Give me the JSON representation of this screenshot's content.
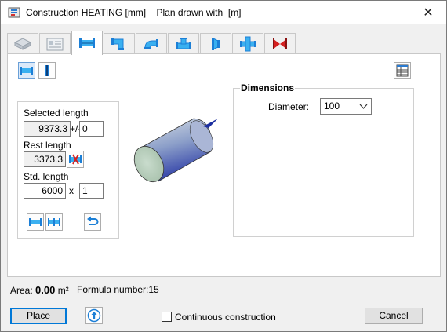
{
  "window": {
    "title": "Construction HEATING [mm]    Plan drawn with  [m]",
    "close_glyph": "✕"
  },
  "tabs": [
    {
      "icon": "slab-icon",
      "active": false
    },
    {
      "icon": "form-icon",
      "active": false
    },
    {
      "icon": "straight-pipe-icon",
      "active": true
    },
    {
      "icon": "elbow-icon",
      "active": false
    },
    {
      "icon": "bend-icon",
      "active": false
    },
    {
      "icon": "tee-icon",
      "active": false
    },
    {
      "icon": "reducer-icon",
      "active": false
    },
    {
      "icon": "cross-icon",
      "active": false
    },
    {
      "icon": "valve-icon",
      "active": false
    }
  ],
  "lengths": {
    "selected_label": "Selected length",
    "selected_value": "9373.3",
    "tolerance_label": "+/-",
    "tolerance_value": "0",
    "rest_label": "Rest length",
    "rest_value": "3373.3",
    "std_label": "Std. length",
    "std_value": "6000",
    "times_label": "x",
    "count_value": "1"
  },
  "dimensions": {
    "title": "Dimensions",
    "diameter_label": "Diameter:",
    "diameter_value": "100"
  },
  "status": {
    "area_label": "Area:",
    "area_value": "0.00",
    "area_unit": "m²",
    "formula_label": "Formula number:15"
  },
  "buttons": {
    "place": "Place",
    "continuous": "Continuous construction",
    "cancel": "Cancel"
  },
  "colors": {
    "accent": "#0078d7",
    "pipe_blue": "#1c7fd6",
    "valve_red": "#d42020"
  }
}
